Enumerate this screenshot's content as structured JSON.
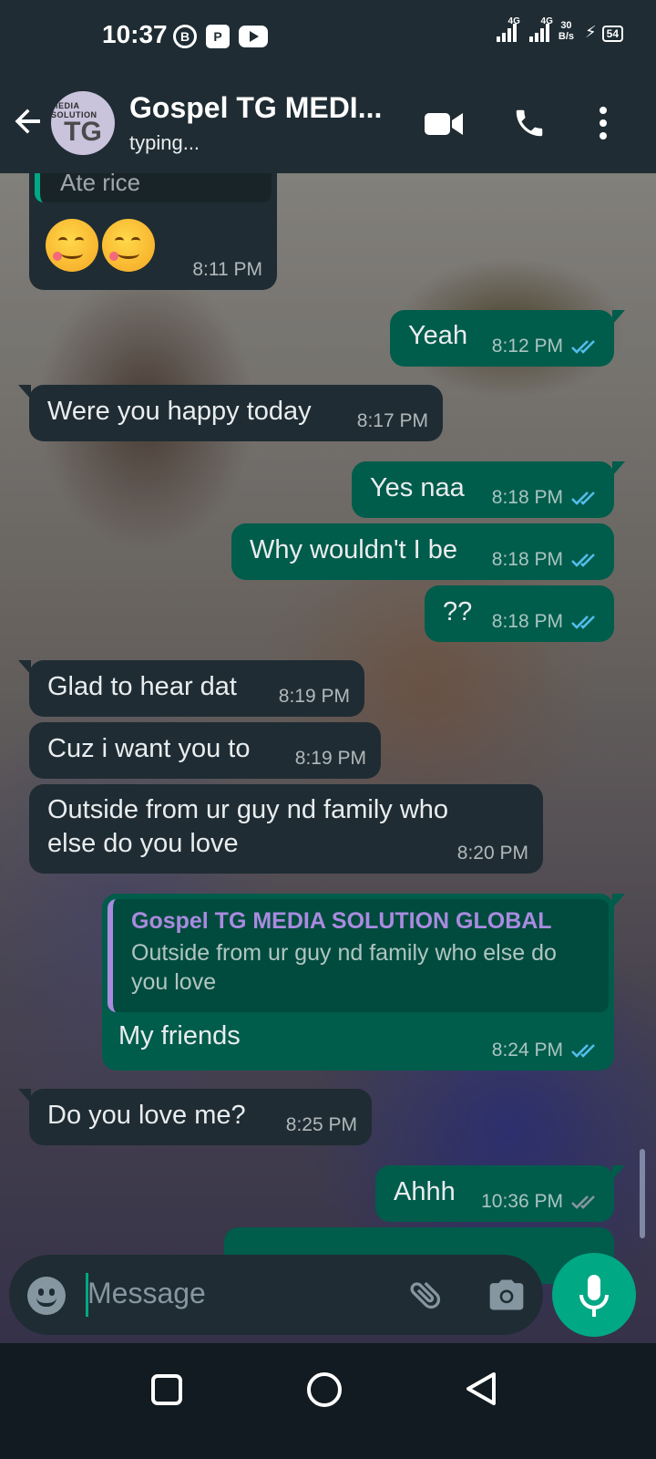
{
  "status_bar": {
    "time": "10:37",
    "badge_left": "B",
    "badge_mid": "P",
    "network": "4G",
    "network2": "4G",
    "speed_value": "30",
    "speed_unit": "B/s",
    "battery": "54"
  },
  "header": {
    "contact_name": "Gospel TG MEDI...",
    "status": "typing...",
    "avatar_text_top": "MEDIA SOLUTION",
    "avatar_text_main": "TG"
  },
  "messages": [
    {
      "dir": "in",
      "quote_text": "Ate rice",
      "time": "8:11 PM"
    },
    {
      "dir": "out",
      "text": "Yeah",
      "time": "8:12 PM"
    },
    {
      "dir": "in",
      "text": "Were you happy today",
      "time": "8:17 PM"
    },
    {
      "dir": "out",
      "text": "Yes naa",
      "time": "8:18 PM"
    },
    {
      "dir": "out",
      "text": "Why wouldn't I be",
      "time": "8:18 PM"
    },
    {
      "dir": "out",
      "text": "??",
      "time": "8:18 PM"
    },
    {
      "dir": "in",
      "text": "Glad to hear dat",
      "time": "8:19 PM"
    },
    {
      "dir": "in",
      "text": "Cuz i want you to",
      "time": "8:19 PM"
    },
    {
      "dir": "in",
      "text": "Outside from ur guy nd family who else do you love",
      "time": "8:20 PM"
    },
    {
      "dir": "out",
      "quote_sender": "Gospel TG MEDIA SOLUTION GLOBAL",
      "quote_text": "Outside from ur guy nd family who else do you love",
      "text": "My friends",
      "time": "8:24 PM"
    },
    {
      "dir": "in",
      "text": "Do you love me?",
      "time": "8:25 PM"
    },
    {
      "dir": "out",
      "text": "Ahhh",
      "time": "10:36 PM"
    }
  ],
  "input": {
    "placeholder": "Message"
  },
  "colors": {
    "header_bg": "#1f2c33",
    "incoming_bubble": "#1f2c33",
    "outgoing_bubble": "#005c4b",
    "accent": "#00a884",
    "read_tick": "#53bdeb",
    "quote_accent": "#a98be0"
  },
  "icons": [
    "back-arrow-icon",
    "video-call-icon",
    "voice-call-icon",
    "more-options-icon",
    "emoji-icon",
    "attach-icon",
    "camera-icon",
    "mic-icon",
    "nav-recents-icon",
    "nav-home-icon",
    "nav-back-icon"
  ]
}
